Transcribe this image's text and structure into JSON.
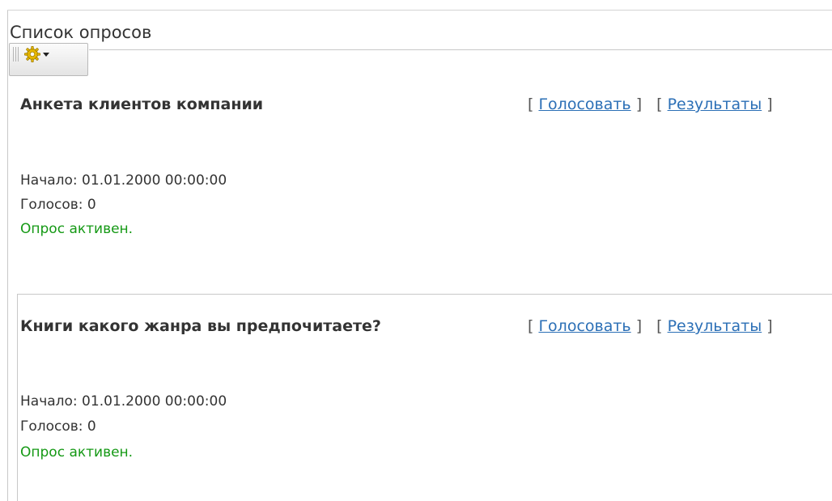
{
  "page": {
    "title": "Список опросов"
  },
  "toolbar": {
    "settings_icon": "gear-icon",
    "dropdown_icon": "chevron-down-icon"
  },
  "polls": [
    {
      "title": "Анкета клиентов компании",
      "vote_label": "Голосовать",
      "results_label": "Результаты",
      "bracket_open": "[",
      "bracket_close": "]",
      "start": "Начало: 01.01.2000 00:00:00",
      "votes": "Голосов: 0",
      "status": "Опрос активен."
    },
    {
      "title": "Книги какого жанра вы предпочитаете?",
      "vote_label": "Голосовать",
      "results_label": "Результаты",
      "bracket_open": "[",
      "bracket_close": "]",
      "start": "Начало: 01.01.2000 00:00:00",
      "votes": "Голосов: 0",
      "status": "Опрос активен."
    }
  ],
  "colors": {
    "link": "#2b6fb6",
    "status_active": "#159915",
    "text": "#333333",
    "border": "#c8c8c8"
  }
}
